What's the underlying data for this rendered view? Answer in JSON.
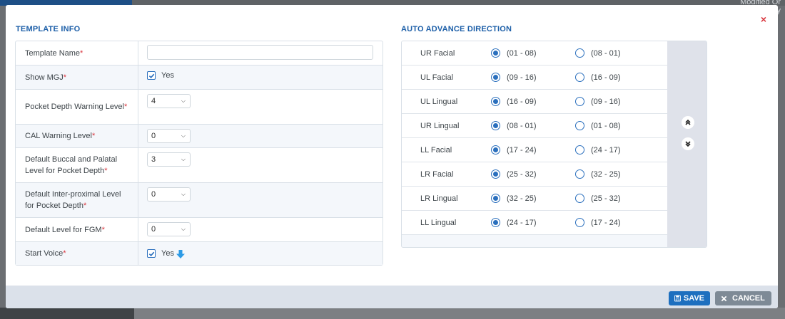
{
  "background": {
    "corner_text_1": "Modified Or",
    "corner_text_2": "dy"
  },
  "modal": {
    "close_symbol": "×",
    "template_info": {
      "title": "TEMPLATE INFO",
      "required_mark": "*",
      "fields": [
        {
          "label": "Template Name",
          "type": "text",
          "value": ""
        },
        {
          "label": "Show MGJ",
          "type": "checkbox",
          "checked": true,
          "value": "Yes"
        },
        {
          "label": "Pocket Depth Warning Level",
          "type": "select",
          "value": "4"
        },
        {
          "label": "CAL Warning Level",
          "type": "select",
          "value": "0"
        },
        {
          "label": "Default Buccal and Palatal Level for Pocket Depth",
          "type": "select",
          "value": "3"
        },
        {
          "label": "Default Inter-proximal Level for Pocket Depth",
          "type": "select",
          "value": "0"
        },
        {
          "label": "Default Level for FGM",
          "type": "select",
          "value": "0"
        },
        {
          "label": "Start Voice",
          "type": "checkbox",
          "checked": true,
          "value": "Yes"
        }
      ]
    },
    "auto_advance": {
      "title": "AUTO ADVANCE DIRECTION",
      "rows": [
        {
          "name": "UR Facial",
          "opt1": "(01 - 08)",
          "opt2": "(08 - 01)",
          "selected": 1
        },
        {
          "name": "UL Facial",
          "opt1": "(09 - 16)",
          "opt2": "(16 - 09)",
          "selected": 1
        },
        {
          "name": "UL Lingual",
          "opt1": "(16 - 09)",
          "opt2": "(09 - 16)",
          "selected": 1
        },
        {
          "name": "UR Lingual",
          "opt1": "(08 - 01)",
          "opt2": "(01 - 08)",
          "selected": 1
        },
        {
          "name": "LL Facial",
          "opt1": "(17 - 24)",
          "opt2": "(24 - 17)",
          "selected": 1
        },
        {
          "name": "LR Facial",
          "opt1": "(25 - 32)",
          "opt2": "(32 - 25)",
          "selected": 1
        },
        {
          "name": "LR Lingual",
          "opt1": "(32 - 25)",
          "opt2": "(25 - 32)",
          "selected": 1
        },
        {
          "name": "LL Lingual",
          "opt1": "(24 - 17)",
          "opt2": "(17 - 24)",
          "selected": 1
        }
      ],
      "up_icon": "double-chevron-up-icon",
      "down_icon": "double-chevron-down-icon"
    },
    "footer": {
      "save_label": "SAVE",
      "cancel_label": "CANCEL"
    }
  },
  "colors": {
    "accent": "#1d6fbf",
    "title": "#1d5fa8",
    "required": "#d9363e",
    "cancel": "#7e8a96"
  }
}
